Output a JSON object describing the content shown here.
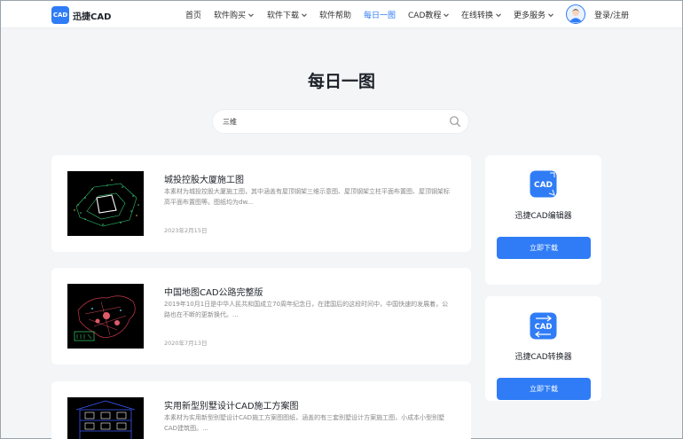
{
  "brand": {
    "logo_text": "迅捷CAD",
    "logo_mark": "CAD"
  },
  "nav": [
    {
      "label": "首页",
      "dropdown": false,
      "active": false
    },
    {
      "label": "软件购买",
      "dropdown": true,
      "active": false
    },
    {
      "label": "软件下载",
      "dropdown": true,
      "active": false
    },
    {
      "label": "软件帮助",
      "dropdown": false,
      "active": false
    },
    {
      "label": "每日一图",
      "dropdown": false,
      "active": true
    },
    {
      "label": "CAD教程",
      "dropdown": true,
      "active": false
    },
    {
      "label": "在线转换",
      "dropdown": true,
      "active": false
    },
    {
      "label": "更多服务",
      "dropdown": true,
      "active": false
    }
  ],
  "user": {
    "login_label": "登录/注册",
    "avatar_icon": "user-avatar-icon"
  },
  "page": {
    "title": "每日一图"
  },
  "search": {
    "value": "三维",
    "icon": "search-icon"
  },
  "articles": [
    {
      "title": "城投控股大厦施工图",
      "description": "本素材为城投控股大厦施工图，其中涵盖有屋顶钢架三维示意图、屋顶钢架立柱平面布置图、屋顶钢架标高平面布置图等。图纸均为dw...",
      "date": "2023年2月15日"
    },
    {
      "title": "中国地图CAD公路完整版",
      "description": "2019年10月1日是中华人民共和国成立70周年纪念日，在建国后的这段时间中，中国快速的发展着，公路也在不断的更新换代。...",
      "date": "2020年7月13日"
    },
    {
      "title": "实用新型别墅设计CAD施工方案图",
      "description": "本素材为实用新型别墅设计CAD施工方案图图纸，涵盖的有三套别墅设计方案施工图，小成本小型别墅CAD建筑图。...",
      "date": ""
    }
  ],
  "sidebar": [
    {
      "name": "迅捷CAD编辑器",
      "button_label": "立即下载",
      "icon": "cad-editor-icon",
      "icon_text": "CAD"
    },
    {
      "name": "迅捷CAD转换器",
      "button_label": "立即下载",
      "icon": "cad-converter-icon",
      "icon_text": "CAD"
    }
  ],
  "colors": {
    "accent": "#2f7cf6",
    "background": "#f4f5f7",
    "card": "#ffffff"
  }
}
